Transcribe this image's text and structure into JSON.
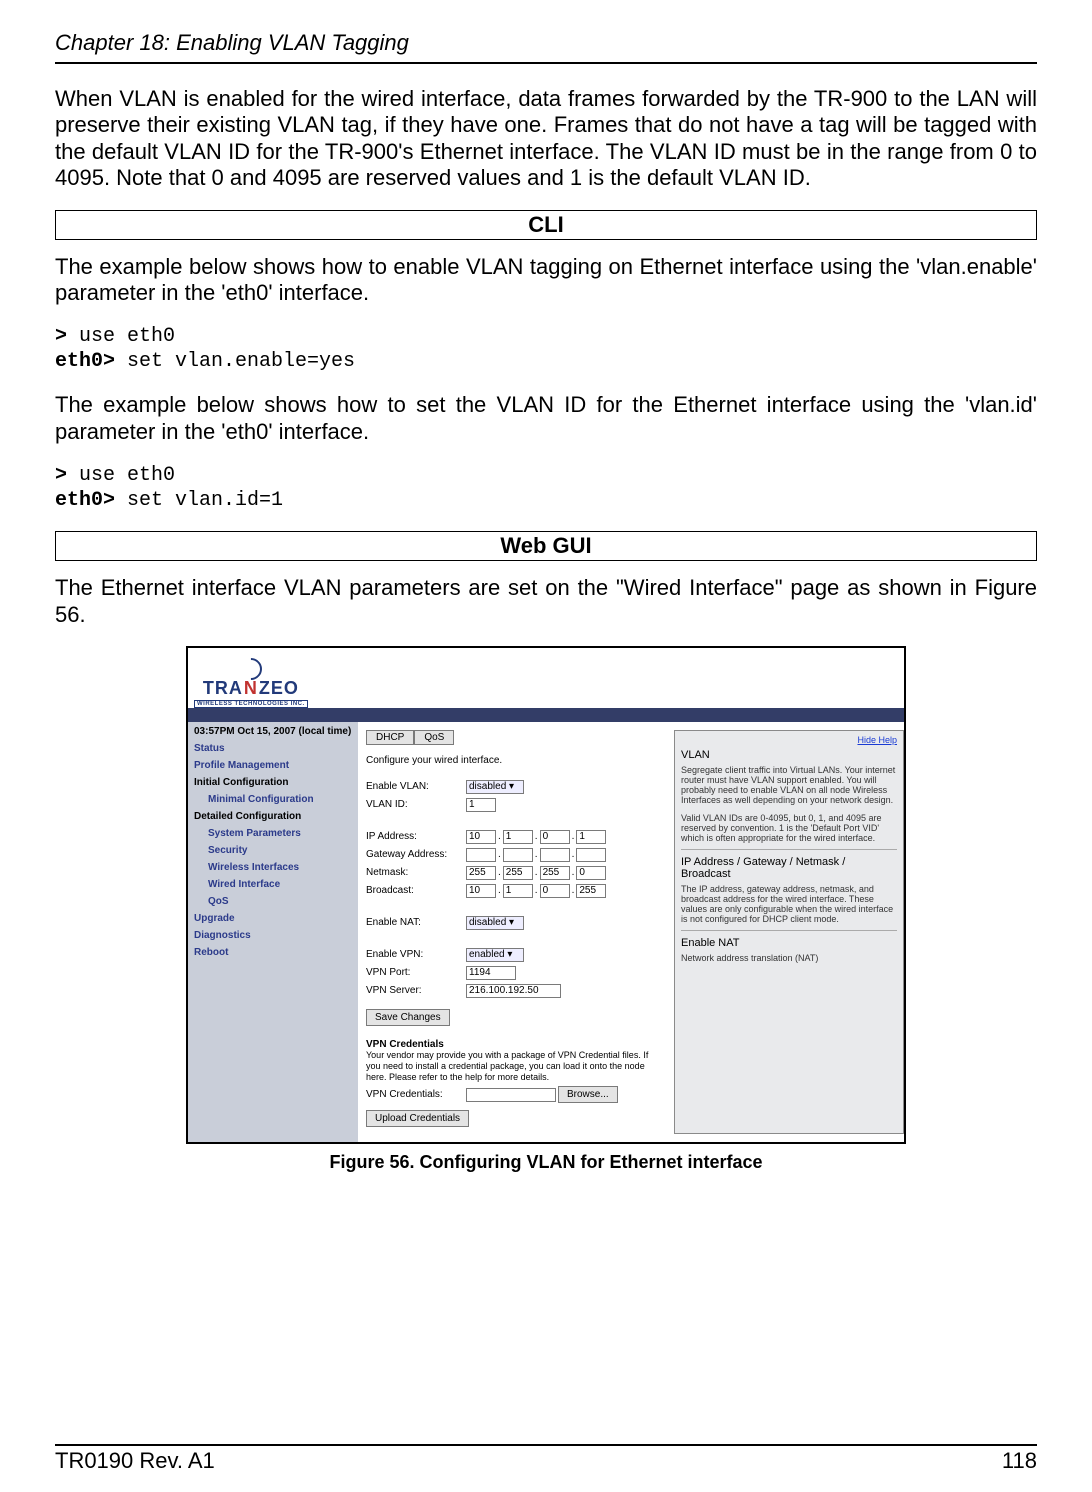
{
  "header": {
    "chapter": "Chapter 18: Enabling VLAN Tagging"
  },
  "para1": "When VLAN is enabled for the wired interface, data frames forwarded by the TR-900 to the LAN will preserve their existing VLAN tag, if they have one. Frames that do not have a tag will be tagged with the default VLAN ID for the TR-900's Ethernet interface. The VLAN ID must be in the range from 0 to 4095. Note that 0 and 4095 are reserved values and 1 is the default VLAN ID.",
  "section_cli": "CLI",
  "para2": "The example below shows how to enable VLAN tagging on Ethernet interface using the 'vlan.enable' parameter in the 'eth0' interface.",
  "cli1": {
    "p1a": ">",
    "p1b": " use eth0",
    "p2a": "eth0>",
    "p2b": " set vlan.enable=yes"
  },
  "para3": "The example below shows how to set the VLAN ID for the Ethernet interface using the 'vlan.id' parameter in the 'eth0' interface.",
  "cli2": {
    "p1a": ">",
    "p1b": " use eth0",
    "p2a": "eth0>",
    "p2b": " set vlan.id=1"
  },
  "section_web": "Web GUI",
  "para4": "The Ethernet interface VLAN parameters are set on the \"Wired Interface\" page as shown in Figure 56.",
  "gui": {
    "logo1": "TRA",
    "logo2": "ZEO",
    "logo_sub": "WIRELESS TECHNOLOGIES INC.",
    "nav": {
      "time": "03:57PM Oct 15, 2007 (local time)",
      "status": "Status",
      "profile": "Profile Management",
      "initial": "Initial Configuration",
      "minimal": "Minimal Configuration",
      "detailed": "Detailed Configuration",
      "sysparams": "System Parameters",
      "security": "Security",
      "wireless": "Wireless Interfaces",
      "wired": "Wired Interface",
      "qos": "QoS",
      "upgrade": "Upgrade",
      "diag": "Diagnostics",
      "reboot": "Reboot"
    },
    "tabs": {
      "dhcp": "DHCP",
      "qos": "QoS"
    },
    "intro": "Configure your wired interface.",
    "labels": {
      "enable_vlan": "Enable VLAN:",
      "vlan_id": "VLAN ID:",
      "ip": "IP Address:",
      "gw": "Gateway Address:",
      "netmask": "Netmask:",
      "bcast": "Broadcast:",
      "enable_nat": "Enable NAT:",
      "enable_vpn": "Enable VPN:",
      "vpn_port": "VPN Port:",
      "vpn_server": "VPN Server:",
      "save": "Save Changes",
      "vpn_cred_title": "VPN Credentials",
      "vpn_cred_text": "Your vendor may provide you with a package of VPN Credential files. If you need to install a credential package, you can load it onto the node here. Please refer to the help for more details.",
      "vpn_cred_label": "VPN Credentials:",
      "browse": "Browse...",
      "upload": "Upload Credentials"
    },
    "values": {
      "enable_vlan": "disabled",
      "vlan_id": "1",
      "ip": [
        "10",
        "1",
        "0",
        "1"
      ],
      "gw": [
        "",
        "",
        "",
        ""
      ],
      "netmask": [
        "255",
        "255",
        "255",
        "0"
      ],
      "bcast": [
        "10",
        "1",
        "0",
        "255"
      ],
      "enable_nat": "disabled",
      "enable_vpn": "enabled",
      "vpn_port": "1194",
      "vpn_server": "216.100.192.50"
    },
    "help": {
      "hide": "Hide Help",
      "vlan_title": "VLAN",
      "vlan_text": "Segregate client traffic into Virtual LANs. Your internet router must have VLAN support enabled. You will probably need to enable VLAN on all node Wireless Interfaces as well depending on your network design.",
      "vlan_text2": "Valid VLAN IDs are 0-4095, but 0, 1, and 4095 are reserved by convention. 1 is the 'Default Port VID' which is often appropriate for the wired interface.",
      "ip_title": "IP Address / Gateway / Netmask / Broadcast",
      "ip_text": "The IP address, gateway address, netmask, and broadcast address for the wired interface. These values are only configurable when the wired interface is not configured for DHCP client mode.",
      "nat_title": "Enable NAT",
      "nat_text": "Network address translation (NAT)"
    }
  },
  "fig_caption": "Figure 56. Configuring VLAN for Ethernet interface",
  "footer": {
    "left": "TR0190 Rev. A1",
    "right": "118"
  }
}
